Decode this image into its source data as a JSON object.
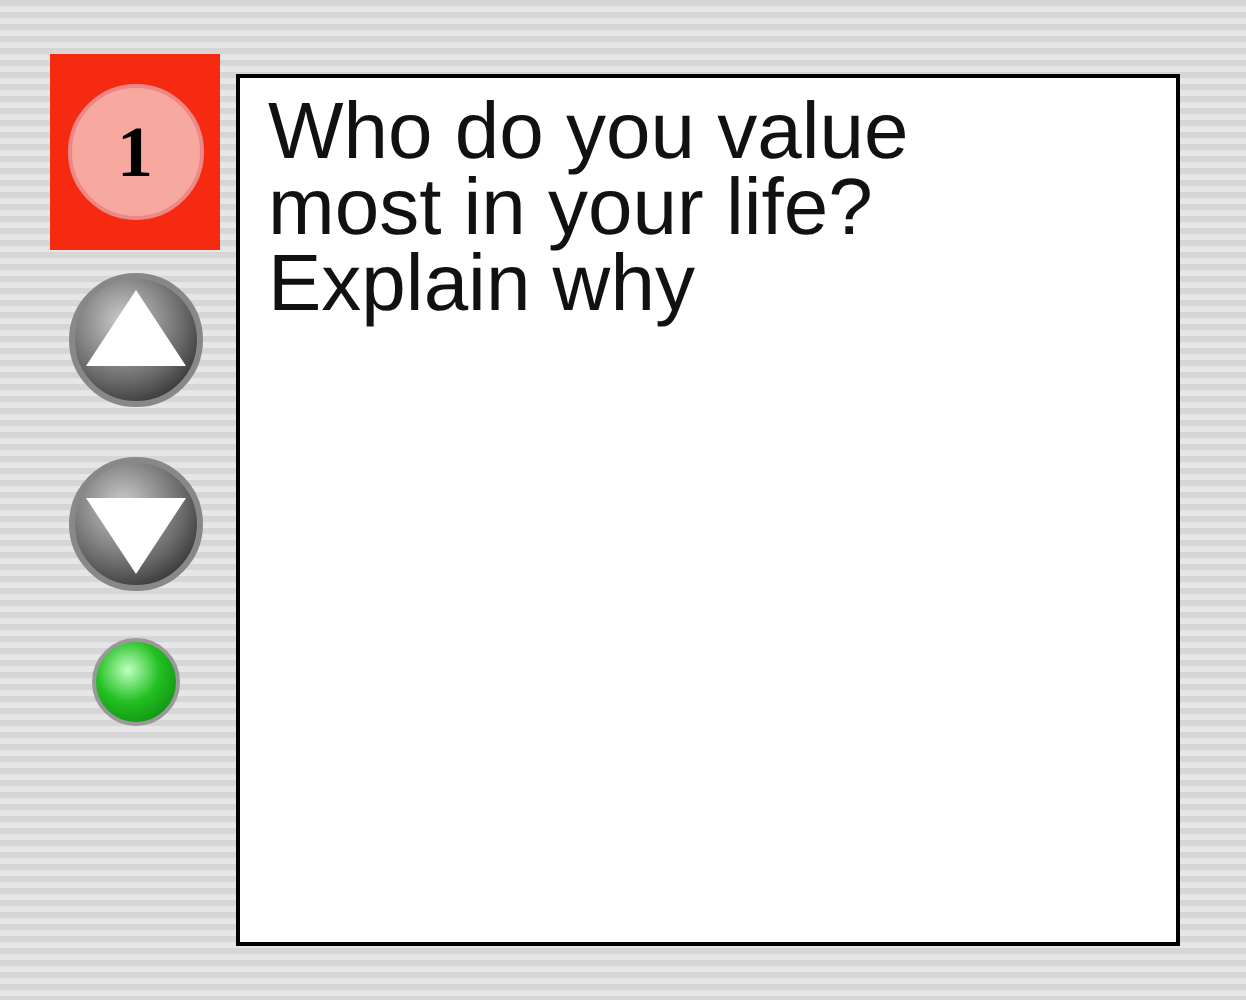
{
  "question_number": "1",
  "question": "Who do you value most in your life? Explain why",
  "status_light": {
    "on": true
  }
}
